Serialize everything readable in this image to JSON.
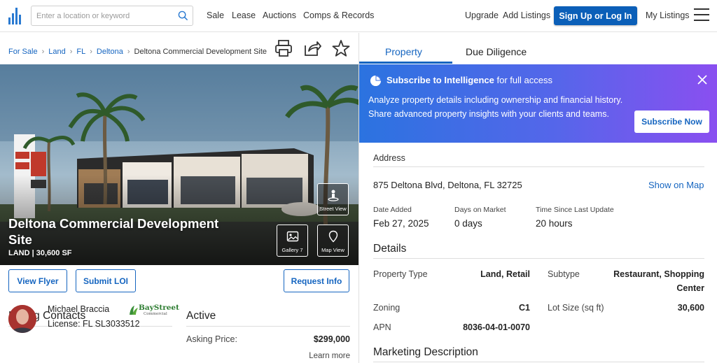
{
  "header": {
    "search_placeholder": "Enter a location or keyword",
    "nav": [
      "Sale",
      "Lease",
      "Auctions",
      "Comps & Records"
    ],
    "upgrade": "Upgrade",
    "add_listings": "Add Listings",
    "signup": "Sign Up or Log In",
    "my_listings": "My Listings"
  },
  "breadcrumb": {
    "items": [
      "For Sale",
      "Land",
      "FL",
      "Deltona"
    ],
    "current": "Deltona Commercial Development Site"
  },
  "hero": {
    "title": "Deltona Commercial Development Site",
    "subtitle": "LAND | 30,600 SF",
    "street_view": "Street View",
    "gallery": "Gallery 7",
    "map_view": "Map View"
  },
  "actions": {
    "view_flyer": "View Flyer",
    "submit_loi": "Submit LOI",
    "request_info": "Request Info"
  },
  "contacts": {
    "heading": "Listing Contacts",
    "name": "Michael Braccia",
    "license": "License: FL SL3033512",
    "brand": "BayStreet",
    "brand_sub": "Commercial"
  },
  "status": {
    "heading": "Active",
    "asking_label": "Asking Price:",
    "asking_value": "$299,000",
    "learn_more": "Learn more"
  },
  "tabs": {
    "property": "Property",
    "due_diligence": "Due Diligence"
  },
  "promo": {
    "head_bold": "Subscribe to Intelligence",
    "head_rest": " for full access",
    "body": "Analyze property details including ownership and financial history. Share advanced property insights with your clients and teams.",
    "button": "Subscribe Now"
  },
  "address": {
    "label": "Address",
    "value": "875 Deltona Blvd, Deltona, FL 32725",
    "show_map": "Show on Map"
  },
  "dates": {
    "date_added_label": "Date Added",
    "date_added": "Feb 27, 2025",
    "days_label": "Days on Market",
    "days": "0 days",
    "since_label": "Time Since Last Update",
    "since": "20 hours"
  },
  "details": {
    "heading": "Details",
    "property_type_label": "Property Type",
    "property_type": "Land, Retail",
    "subtype_label": "Subtype",
    "subtype_line1": "Restaurant, Shopping",
    "subtype_line2": "Center",
    "zoning_label": "Zoning",
    "zoning": "C1",
    "lot_label": "Lot Size (sq ft)",
    "lot": "30,600",
    "apn_label": "APN",
    "apn": "8036-04-01-0070"
  },
  "marketing": {
    "heading": "Marketing Description"
  },
  "colors": {
    "brand_blue": "#0b5fb8",
    "link_blue": "#1565c0"
  }
}
